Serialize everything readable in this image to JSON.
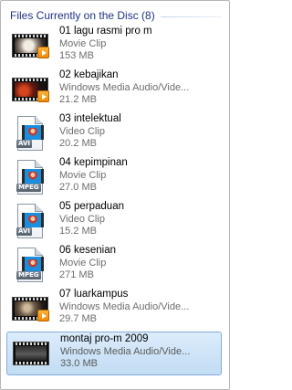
{
  "header": {
    "title": "Files Currently on the Disc (8)"
  },
  "files": [
    {
      "name": "01 lagu rasmi pro m",
      "type": "Movie Clip",
      "size": "153 MB",
      "icon": "video-thumbnail-icon",
      "badge": "play-badge-icon"
    },
    {
      "name": "02 kebajikan",
      "type": "Windows Media Audio/Vide...",
      "size": "21.2 MB",
      "icon": "video-thumbnail-icon",
      "badge": "play-badge-icon"
    },
    {
      "name": "03 intelektual",
      "type": "Video Clip",
      "size": "20.2 MB",
      "icon": "avi-file-icon",
      "tag": "AVI"
    },
    {
      "name": "04 kepimpinan",
      "type": "Movie Clip",
      "size": "27.0 MB",
      "icon": "mpeg-file-icon",
      "tag": "MPEG"
    },
    {
      "name": "05 perpaduan",
      "type": "Video Clip",
      "size": "15.2 MB",
      "icon": "avi-file-icon",
      "tag": "AVI"
    },
    {
      "name": "06 kesenian",
      "type": "Movie Clip",
      "size": "271 MB",
      "icon": "mpeg-file-icon",
      "tag": "MPEG"
    },
    {
      "name": "07 luarkampus",
      "type": "Windows Media Audio/Vide...",
      "size": "29.7 MB",
      "icon": "video-thumbnail-icon",
      "badge": "play-badge-icon"
    },
    {
      "name": "montaj pro-m 2009",
      "type": "Windows Media Audio/Vide...",
      "size": "33.0 MB",
      "icon": "video-thumbnail-icon",
      "selected": true
    }
  ],
  "colors": {
    "header_text": "#1e3287",
    "selection": "#c1dcf3",
    "secondary_text": "#6d6d6d"
  }
}
